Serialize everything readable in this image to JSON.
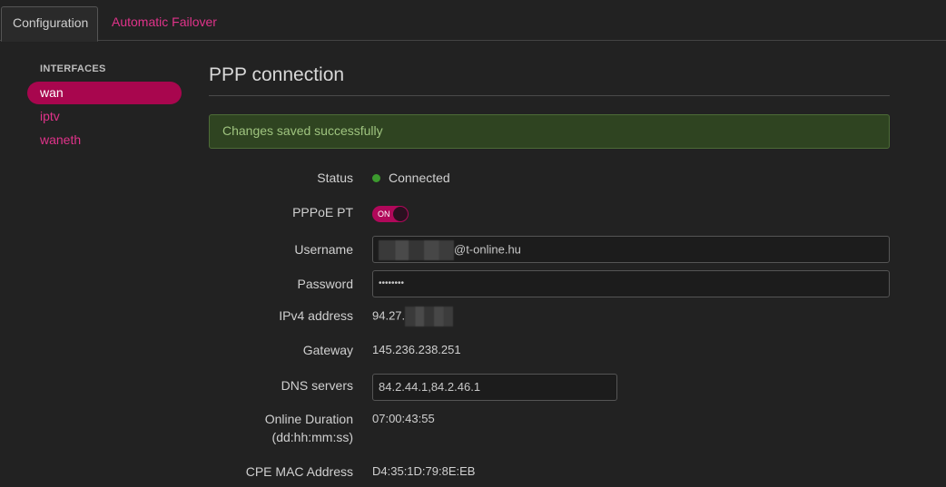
{
  "tabs": [
    {
      "label": "Configuration",
      "active": true
    },
    {
      "label": "Automatic Failover",
      "active": false
    }
  ],
  "sidebar": {
    "heading": "INTERFACES",
    "items": [
      {
        "label": "wan",
        "active": true
      },
      {
        "label": "iptv",
        "active": false
      },
      {
        "label": "waneth",
        "active": false
      }
    ]
  },
  "main": {
    "title": "PPP connection",
    "alert": "Changes saved successfully",
    "fields": {
      "status": {
        "label": "Status",
        "value": "Connected"
      },
      "pppoe": {
        "label": "PPPoE PT",
        "toggle": "ON"
      },
      "username": {
        "label": "Username",
        "value_suffix": "@t-online.hu"
      },
      "password": {
        "label": "Password",
        "value": "••••••••"
      },
      "ipv4": {
        "label": "IPv4 address",
        "value_prefix": "94.27."
      },
      "gateway": {
        "label": "Gateway",
        "value": "145.236.238.251"
      },
      "dns": {
        "label": "DNS servers",
        "value": "84.2.44.1,84.2.46.1"
      },
      "duration": {
        "label_line1": "Online Duration",
        "label_line2": "(dd:hh:mm:ss)",
        "value": "07:00:43:55"
      },
      "mac": {
        "label": "CPE MAC Address",
        "value": "D4:35:1D:79:8E:EB"
      }
    }
  },
  "colors": {
    "accent": "#e0338a",
    "accent_active": "#a8064e",
    "status_ok": "#3c9a2e",
    "alert_bg": "#2f4421"
  }
}
